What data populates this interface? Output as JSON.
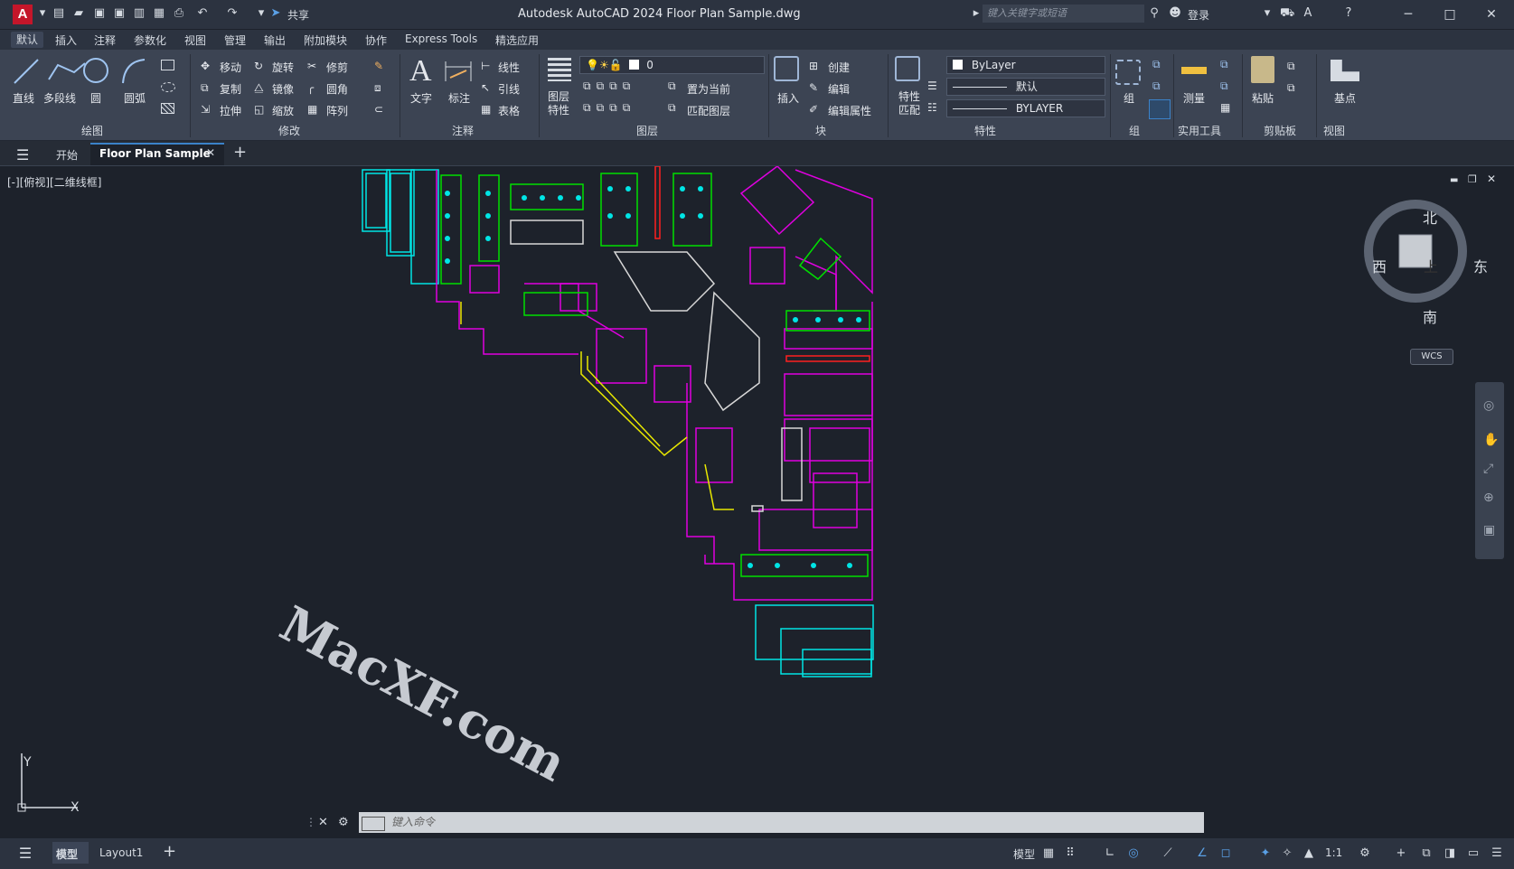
{
  "titlebar": {
    "app_logo": "A",
    "share_label": "共享",
    "title": "Autodesk AutoCAD 2024    Floor Plan Sample.dwg",
    "search_placeholder": "键入关键字或短语",
    "login_label": "登录"
  },
  "menu": {
    "tabs": [
      "默认",
      "插入",
      "注释",
      "参数化",
      "视图",
      "管理",
      "输出",
      "附加模块",
      "协作",
      "Express Tools",
      "精选应用"
    ]
  },
  "ribbon": {
    "draw": {
      "line": "直线",
      "polyline": "多段线",
      "circle": "圆",
      "arc": "圆弧",
      "title": "绘图"
    },
    "modify": {
      "move": "移动",
      "rotate": "旋转",
      "trim": "修剪",
      "copy": "复制",
      "mirror": "镜像",
      "fillet": "圆角",
      "stretch": "拉伸",
      "scale": "缩放",
      "array": "阵列",
      "title": "修改"
    },
    "annotation": {
      "text": "文字",
      "dimension": "标注",
      "linear": "线性",
      "leader": "引线",
      "table": "表格",
      "title": "注释"
    },
    "layers": {
      "layer_props": "图层特性",
      "current_layer": "0",
      "set_current": "置为当前",
      "match_layer": "匹配图层",
      "title": "图层"
    },
    "block": {
      "insert": "插入",
      "create": "创建",
      "edit": "编辑",
      "edit_attr": "编辑属性",
      "title": "块"
    },
    "properties": {
      "match": "特性匹配",
      "color": "ByLayer",
      "lineweight": "默认",
      "linetype": "BYLAYER",
      "title": "特性"
    },
    "groups": {
      "group": "组",
      "title": "组"
    },
    "utilities": {
      "measure": "测量",
      "title": "实用工具"
    },
    "clipboard": {
      "paste": "粘贴",
      "title": "剪贴板"
    },
    "view": {
      "base": "基点",
      "title": "视图"
    }
  },
  "filetabs": {
    "start": "开始",
    "active": "Floor Plan Sample"
  },
  "viewport": {
    "label": "[-][俯视][二维线框]",
    "compass": {
      "north": "北",
      "south": "南",
      "east": "东",
      "west": "西",
      "top": "上",
      "wcs": "WCS"
    },
    "ucs": {
      "y": "Y",
      "x": "X"
    }
  },
  "command": {
    "placeholder": "键入命令"
  },
  "statusbar": {
    "model_tab": "模型",
    "layout_tab": "Layout1",
    "model_label": "模型",
    "scale": "1:1"
  },
  "watermark": {
    "text": "MacXF.com"
  },
  "colors": {
    "accent": "#3b82c9",
    "cyan": "#00e5e5",
    "magenta": "#e000e0",
    "yellow": "#e8e800",
    "green": "#00e000",
    "white": "#e6e6e6",
    "red": "#ff2020"
  }
}
